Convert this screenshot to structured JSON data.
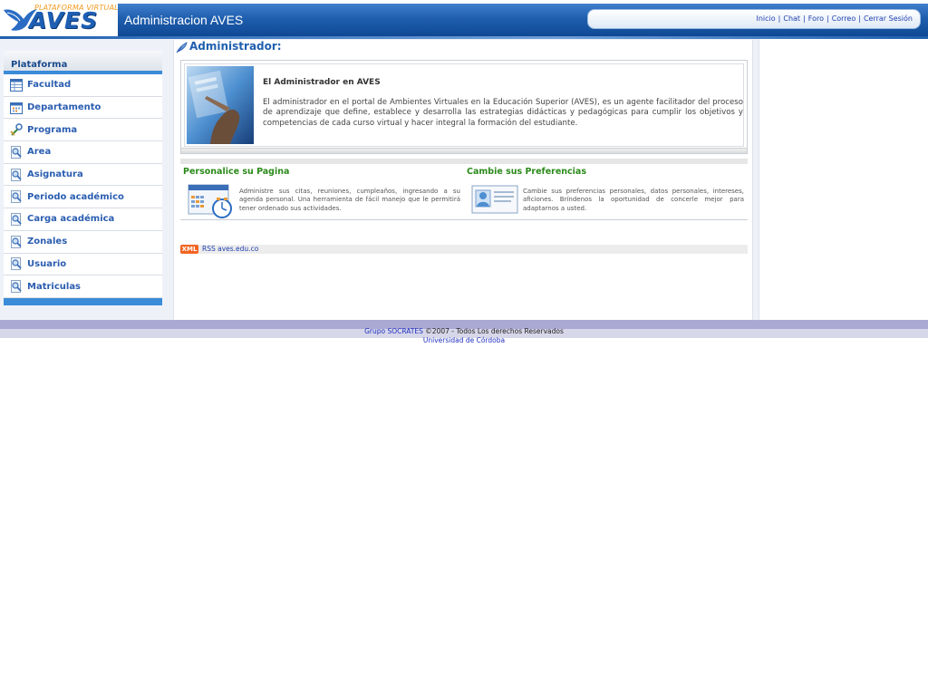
{
  "header": {
    "logo_tagline": "PLATAFORMA VIRTUAL",
    "logo_name": "AVES",
    "site_title": "Administracion AVES",
    "nav": [
      "Inicio",
      "Chat",
      "Foro",
      "Correo",
      "Cerrar Sesión"
    ]
  },
  "sidebar": {
    "heading": "Plataforma",
    "items": [
      {
        "label": "Facultad",
        "icon": "table-icon"
      },
      {
        "label": "Departamento",
        "icon": "calendar-icon"
      },
      {
        "label": "Programa",
        "icon": "tools-icon"
      },
      {
        "label": "Area",
        "icon": "magnifier-doc-icon"
      },
      {
        "label": "Asignatura",
        "icon": "magnifier-doc-icon"
      },
      {
        "label": "Periodo académico",
        "icon": "magnifier-doc-icon"
      },
      {
        "label": "Carga académica",
        "icon": "magnifier-doc-icon"
      },
      {
        "label": "Zonales",
        "icon": "magnifier-doc-icon"
      },
      {
        "label": "Usuario",
        "icon": "magnifier-doc-icon"
      },
      {
        "label": "Matriculas",
        "icon": "magnifier-doc-icon"
      }
    ]
  },
  "main": {
    "title": "Administrador:",
    "intro": {
      "heading": "El Administrador en AVES",
      "text": "El administrador en el portal de Ambientes Virtuales en la Educación Superior (AVES), es un agente facilitador del proceso de aprendizaje que define, establece y desarrolla las estrategias didácticas y pedagógicas para cumplir los objetivos y competencias de cada curso virtual y hacer integral la formación del estudiante."
    },
    "features": [
      {
        "title": "Personalice su Pagina",
        "icon": "calendar-clock-icon",
        "text": "Administre sus citas, reuniones, cumpleaños, ingresando a su agenda personal. Una herramienta de fácil manejo que le permitirá tener ordenado sus actividades."
      },
      {
        "title": "Cambie sus Preferencias",
        "icon": "profile-card-icon",
        "text": "Cambie sus preferencias personales, datos personales, intereses, aficiones. Bríndenos la oportunidad de concerle mejor para adaptarnos a usted."
      }
    ],
    "rss": {
      "badge": "XML",
      "label": "RSS aves.edu.co"
    }
  },
  "footer": {
    "line1_link": "Grupo SOCRATES",
    "line1_rest": " ©2007 - Todos Los derechos Reservados",
    "line2_link": "Universidad de Córdoba"
  },
  "colors": {
    "brand_blue": "#1f5fae",
    "accent_orange": "#f39a1d",
    "feature_green": "#2b8a1a",
    "footer_purple": "#a9a9d4"
  }
}
